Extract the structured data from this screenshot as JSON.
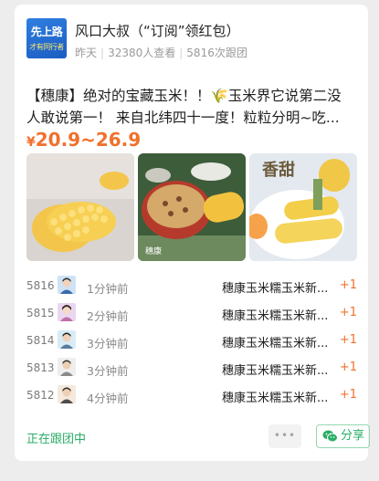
{
  "header": {
    "avatar_text_main": "先上路",
    "avatar_text_sub": "才有同行者",
    "author_name": "风口大叔（“订阅”领红包）",
    "meta_time": "昨天",
    "meta_views": "32380人查看",
    "meta_followers": "5816次跟团"
  },
  "post": {
    "title_line1": "【穗康】绝对的宝藏玉米！！🌾玉米界它说第二没",
    "title_line2": "人敢说第一！ 来自北纬四十一度！粒粒分明~吃...",
    "price_currency": "¥",
    "price_range": "20.9~26.9",
    "photos": [
      {
        "icon": "corn-photo",
        "caption": ""
      },
      {
        "icon": "corn-bowl-photo",
        "caption": "穗康"
      },
      {
        "icon": "corn-on-plate-photo",
        "caption": "香甜"
      }
    ]
  },
  "orders": [
    {
      "number": "5816",
      "time": "1分钟前",
      "product": "穗康玉米糯玉米新...",
      "qty": "+1"
    },
    {
      "number": "5815",
      "time": "2分钟前",
      "product": "穗康玉米糯玉米新...",
      "qty": "+1"
    },
    {
      "number": "5814",
      "time": "3分钟前",
      "product": "穗康玉米糯玉米新...",
      "qty": "+1"
    },
    {
      "number": "5813",
      "time": "3分钟前",
      "product": "穗康玉米糯玉米新...",
      "qty": "+1"
    },
    {
      "number": "5812",
      "time": "4分钟前",
      "product": "穗康玉米糯玉米新...",
      "qty": "+1"
    }
  ],
  "footer": {
    "status": "正在跟团中",
    "more_label": "•••",
    "share_label": "分享"
  },
  "colors": {
    "accent_orange": "#f0712c",
    "accent_green": "#2aae67",
    "card_bg": "#ffffff",
    "page_bg": "#ededed"
  }
}
